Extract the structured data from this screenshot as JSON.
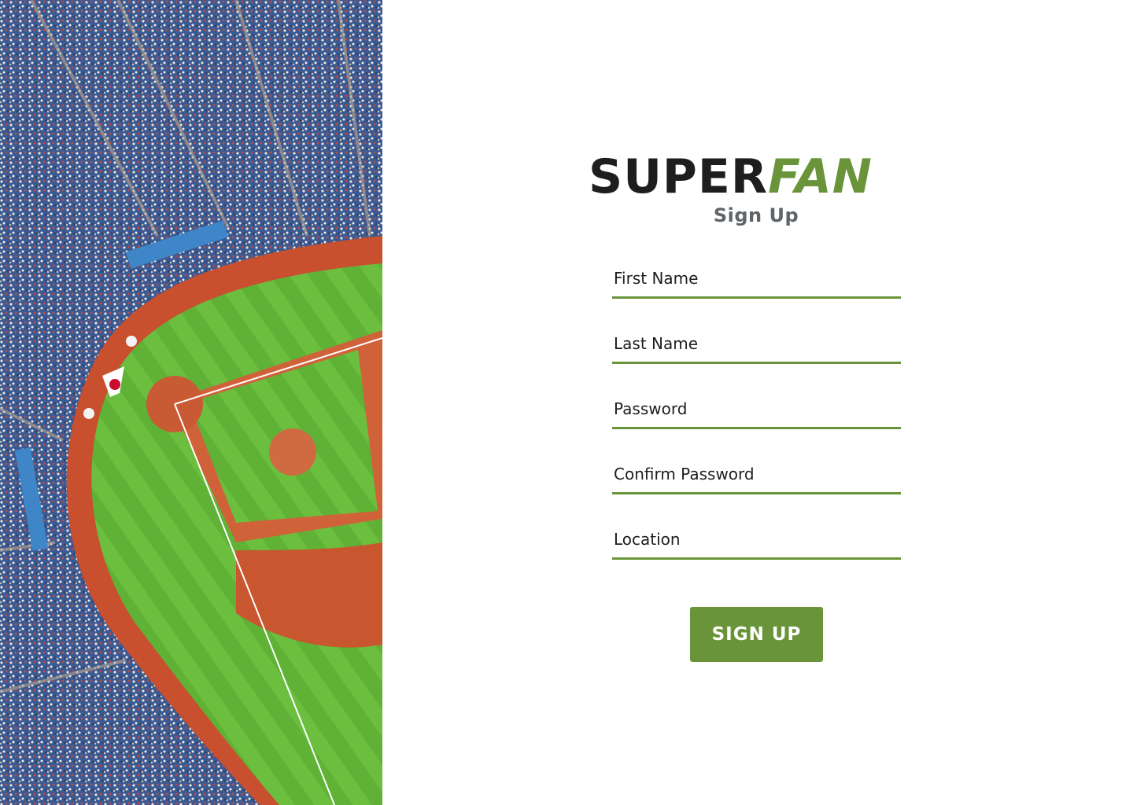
{
  "brand": {
    "name_part1": "SUPER",
    "name_part2": "FAN",
    "dark_color": "#1e1e1e",
    "accent_color": "#6a9439"
  },
  "page": {
    "subtitle": "Sign Up"
  },
  "form": {
    "fields": [
      {
        "placeholder": "First Name",
        "value": ""
      },
      {
        "placeholder": "Last Name",
        "value": ""
      },
      {
        "placeholder": "Password",
        "value": ""
      },
      {
        "placeholder": "Confirm Password",
        "value": ""
      },
      {
        "placeholder": "Location",
        "value": ""
      }
    ],
    "submit_label": "SIGN UP"
  },
  "hero": {
    "image": "stadium-aerial-photo"
  }
}
